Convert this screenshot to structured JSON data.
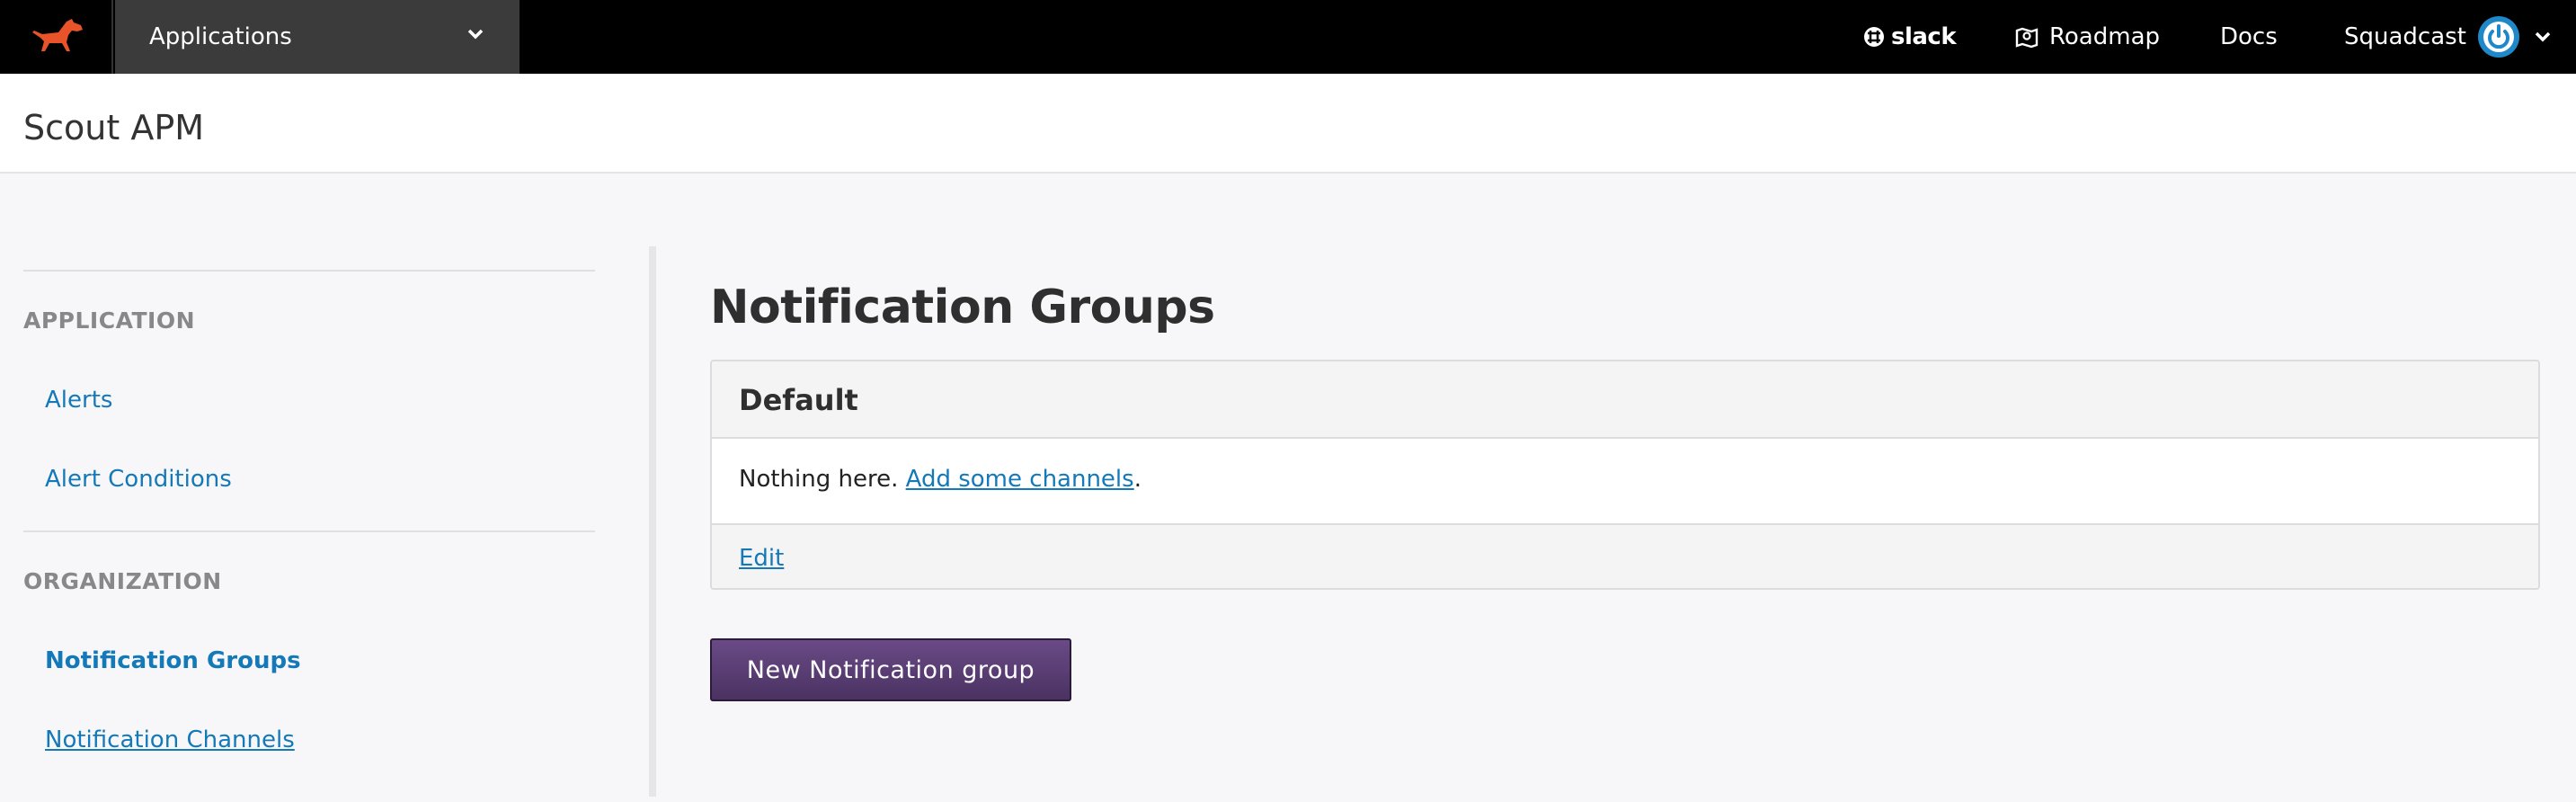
{
  "topbar": {
    "app_switcher_label": "Applications",
    "slack_label": "slack",
    "roadmap_label": "Roadmap",
    "docs_label": "Docs",
    "user_label": "Squadcast"
  },
  "header": {
    "title": "Scout APM"
  },
  "sidebar": {
    "sections": [
      {
        "heading": "APPLICATION",
        "items": [
          "Alerts",
          "Alert Conditions"
        ]
      },
      {
        "heading": "ORGANIZATION",
        "items": [
          "Notification Groups",
          "Notification Channels"
        ]
      }
    ],
    "active_item": "Notification Groups"
  },
  "main": {
    "title": "Notification Groups",
    "group": {
      "name": "Default",
      "empty_text": "Nothing here.",
      "add_link": "Add some channels",
      "trailing": ".",
      "edit_link": "Edit"
    },
    "new_button": "New Notification group"
  },
  "colors": {
    "topbar": "#000000",
    "link": "#1479b8",
    "button": "#5a3d74",
    "logo": "#e8532a",
    "power": "#1e88c8"
  },
  "icons": [
    "dog-logo-icon",
    "chevron-down-icon",
    "slack-icon",
    "roadmap-icon",
    "power-icon"
  ]
}
